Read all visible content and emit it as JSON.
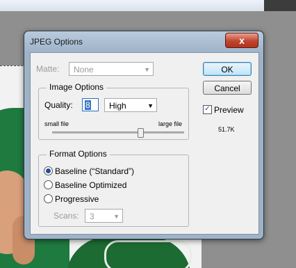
{
  "dialog": {
    "title": "JPEG Options",
    "close_label": "x",
    "matte_label": "Matte:",
    "matte_value": "None",
    "image_options": {
      "title": "Image Options",
      "quality_label": "Quality:",
      "quality_value": "8",
      "quality_level": "High",
      "small_file_label": "small file",
      "large_file_label": "large file",
      "slider_fraction": 0.67
    },
    "format_options": {
      "title": "Format Options",
      "options": [
        "Baseline (“Standard”)",
        "Baseline Optimized",
        "Progressive"
      ],
      "selected_index": 0,
      "scans_label": "Scans:",
      "scans_value": "3"
    },
    "buttons": {
      "ok": "OK",
      "cancel": "Cancel"
    },
    "preview": {
      "label": "Preview",
      "checked": true,
      "size": "51.7K"
    }
  }
}
